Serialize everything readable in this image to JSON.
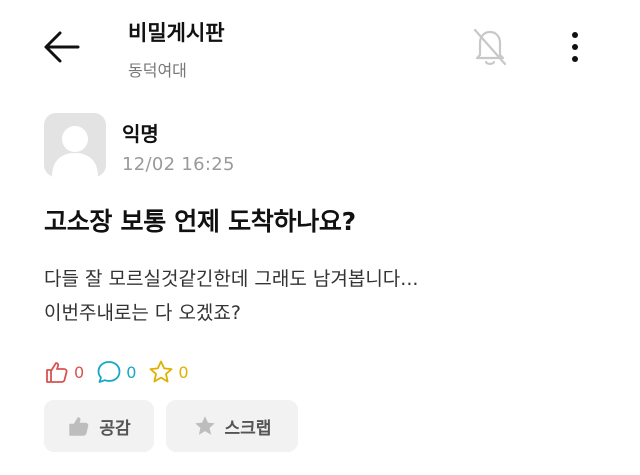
{
  "header": {
    "board_title": "비밀게시판",
    "board_subtitle": "동덕여대",
    "icons": {
      "back": "arrow-left-icon",
      "notification": "bell-off-icon",
      "more": "more-vertical-icon"
    }
  },
  "post": {
    "author": "익명",
    "time": "12/02 16:25",
    "title": "고소장 보통 언제 도착하나요?",
    "body_lines": [
      "다들 잘 모르실것같긴한데 그래도 남겨봅니다...",
      "이번주내로는 다 오겠죠?"
    ],
    "stats": {
      "likes": "0",
      "comments": "0",
      "scraps": "0"
    }
  },
  "actions": {
    "like_label": "공감",
    "scrap_label": "스크랩"
  },
  "colors": {
    "like": "#d9534f",
    "comment": "#16a7c7",
    "scrap": "#e0b000",
    "button_bg": "#f2f2f2",
    "muted": "#9a9a9a"
  }
}
